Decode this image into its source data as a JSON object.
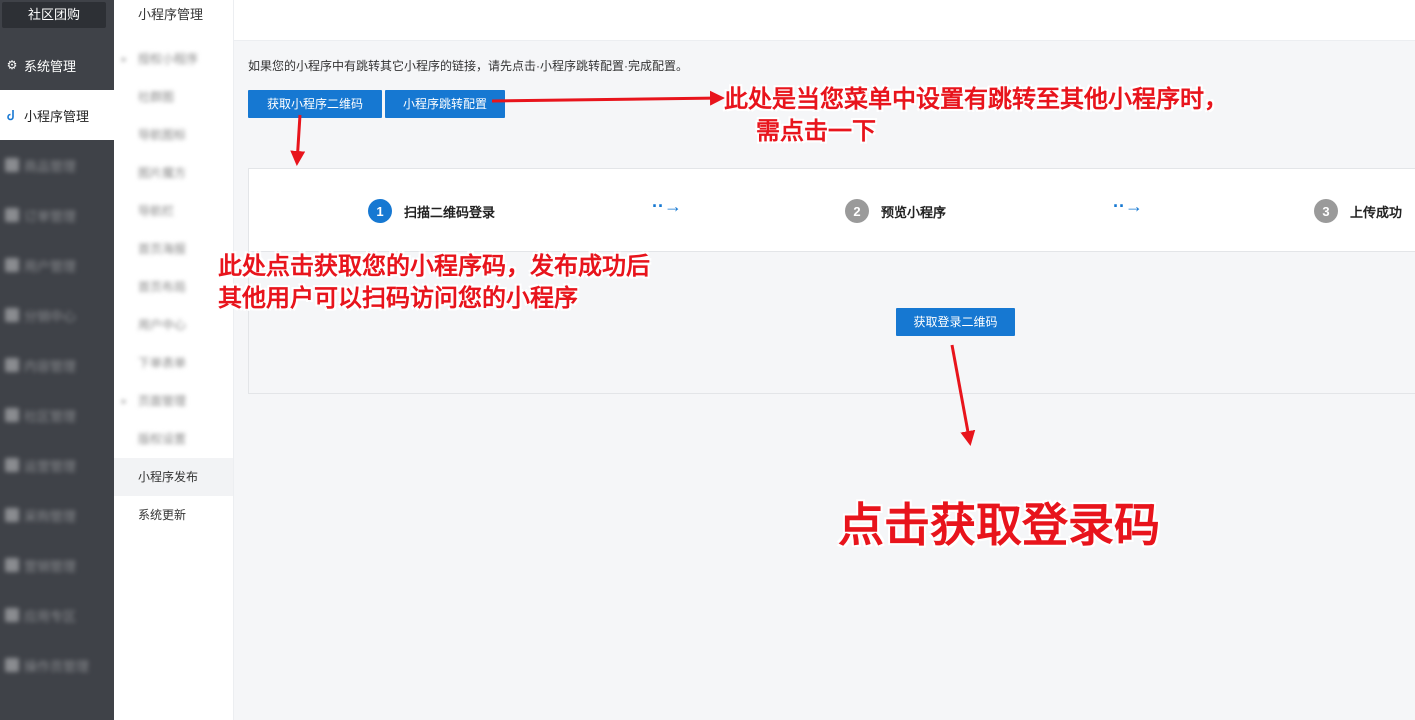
{
  "sidebar": {
    "brand": "社区团购",
    "items": [
      {
        "label": "系统管理",
        "icon": "gear-icon"
      },
      {
        "label": "小程序管理",
        "icon": "link-icon"
      },
      {
        "label": "商品管理"
      },
      {
        "label": "订单管理"
      },
      {
        "label": "用户管理"
      },
      {
        "label": "分销中心"
      },
      {
        "label": "内容管理"
      },
      {
        "label": "社区管理"
      },
      {
        "label": "运营管理"
      },
      {
        "label": "采购管理"
      },
      {
        "label": "营销管理"
      },
      {
        "label": "应用专区"
      },
      {
        "label": "操作员管理"
      }
    ]
  },
  "subnav": {
    "title": "小程序管理",
    "items": [
      {
        "label": "授权小程序"
      },
      {
        "label": "社群图"
      },
      {
        "label": "导航图标"
      },
      {
        "label": "图片魔方"
      },
      {
        "label": "导航栏"
      },
      {
        "label": "首页海报"
      },
      {
        "label": "首页布局"
      },
      {
        "label": "用户中心"
      },
      {
        "label": "下单表单"
      },
      {
        "label": "页面管理"
      },
      {
        "label": "版权设置"
      },
      {
        "label": "小程序发布"
      },
      {
        "label": "系统更新"
      }
    ]
  },
  "main": {
    "notice": "如果您的小程序中有跳转其它小程序的链接，请先点击·小程序跳转配置·完成配置。",
    "get_qr_button": "获取小程序二维码",
    "jump_config_button": "小程序跳转配置",
    "steps": [
      {
        "num": "1",
        "label": "扫描二维码登录"
      },
      {
        "num": "2",
        "label": "预览小程序"
      },
      {
        "num": "3",
        "label": "上传成功"
      }
    ],
    "step_arrow": "··→",
    "login_qr_button": "获取登录二维码"
  },
  "annotations": {
    "jump_note_line1": "此处是当您菜单中设置有跳转至其他小程序时，",
    "jump_note_line2": "需点击一下",
    "qr_note_line1": "此处点击获取您的小程序码，发布成功后",
    "qr_note_line2": "其他用户可以扫码访问您的小程序",
    "login_note": "点击获取登录码",
    "arrow_color": "#e8141c"
  },
  "colors": {
    "primary": "#1678d2",
    "sidebar_dark": "#3f4248",
    "annotation_red": "#e8141c"
  }
}
